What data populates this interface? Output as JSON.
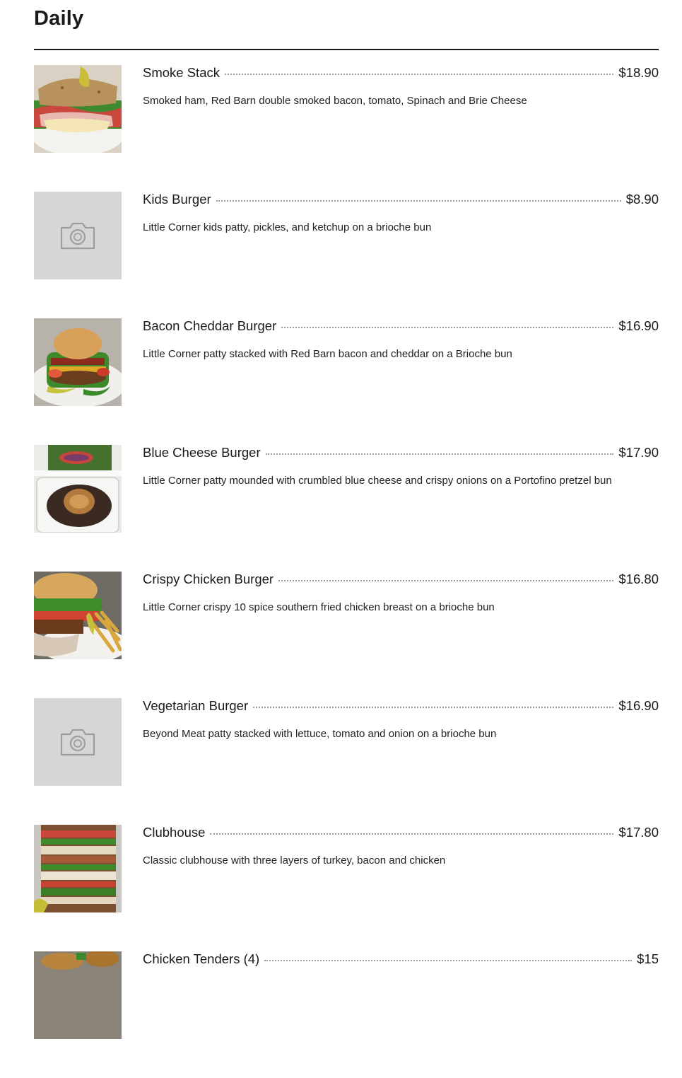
{
  "page": {
    "title": "Daily"
  },
  "colors": {
    "text": "#1a1a1a",
    "placeholder_bg": "#d6d6d6",
    "leader": "#9a9a9a"
  },
  "items": [
    {
      "name": "Smoke Stack",
      "price": "$18.90",
      "description": "Smoked ham, Red Barn double smoked bacon, tomato, Spinach and Brie Cheese",
      "image": "sandwich-photo"
    },
    {
      "name": "Kids Burger",
      "price": "$8.90",
      "description": "Little Corner kids patty, pickles, and ketchup on a brioche bun",
      "image": "camera-placeholder-icon"
    },
    {
      "name": "Bacon Cheddar Burger",
      "price": "$16.90",
      "description": "Little Corner patty stacked with Red Barn bacon and cheddar on a Brioche bun",
      "image": "burger-photo"
    },
    {
      "name": "Blue Cheese Burger",
      "price": "$17.90",
      "description": "Little Corner patty mounded with crumbled blue cheese and crispy onions on a Portofino pretzel bun",
      "image": "burger-takeout-photo"
    },
    {
      "name": "Crispy Chicken Burger",
      "price": "$16.80",
      "description": "Little Corner crispy 10 spice southern fried chicken breast on a brioche bun",
      "image": "chicken-burger-photo"
    },
    {
      "name": "Vegetarian Burger",
      "price": "$16.90",
      "description": "Beyond Meat patty stacked with lettuce, tomato and onion on a brioche bun",
      "image": "camera-placeholder-icon"
    },
    {
      "name": "Clubhouse",
      "price": "$17.80",
      "description": "Classic clubhouse with three layers of turkey, bacon and chicken",
      "image": "club-sandwich-photo"
    },
    {
      "name": "Chicken Tenders (4)",
      "price": "$15",
      "description": "",
      "image": "chicken-tenders-photo"
    }
  ]
}
